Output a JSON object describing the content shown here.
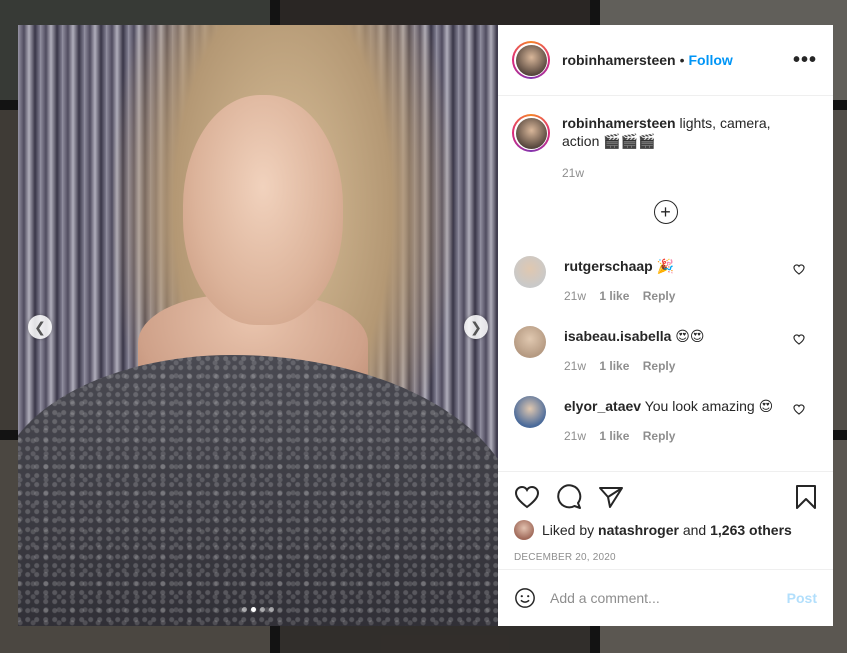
{
  "post": {
    "author": "robinhamersteen",
    "dot": "•",
    "follow_label": "Follow",
    "more_label": "•••",
    "caption_text": "lights, camera, action 🎬🎬🎬",
    "caption_time": "21w",
    "media_dots": 4,
    "media_active_dot": 1
  },
  "comments": [
    {
      "user": "rutgerschaap",
      "text": "🎉",
      "time": "21w",
      "likes": "1 like",
      "reply": "Reply"
    },
    {
      "user": "isabeau.isabella",
      "text": "😍😍",
      "time": "21w",
      "likes": "1 like",
      "reply": "Reply"
    },
    {
      "user": "elyor_ataev",
      "text": "You look amazing 😍",
      "time": "21w",
      "likes": "1 like",
      "reply": "Reply"
    }
  ],
  "likes": {
    "prefix": "Liked by",
    "user": "natashroger",
    "middle": "and",
    "others": "1,263 others"
  },
  "date": "DECEMBER 20, 2020",
  "add_comment": {
    "placeholder": "Add a comment...",
    "post_label": "Post"
  },
  "colors": {
    "accent": "#0095f6",
    "post_disabled": "#b2dffc",
    "muted": "#8e8e8e"
  }
}
